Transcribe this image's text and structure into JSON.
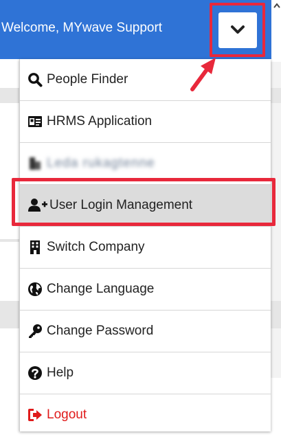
{
  "header": {
    "welcome_text": "Welcome, MYwave Support",
    "toggle_icon": "chevron-down-icon",
    "background": "#2f73d6"
  },
  "menu": {
    "items": [
      {
        "label": "People Finder",
        "icon": "search-icon"
      },
      {
        "label": "HRMS Application",
        "icon": "id-card-icon"
      },
      {
        "label": "Leda rukagtenne",
        "icon": "building-icon",
        "blurred": true
      },
      {
        "label": "User Login Management",
        "icon": "user-plus-icon",
        "highlighted": true
      },
      {
        "label": "Switch Company",
        "icon": "building-icon"
      },
      {
        "label": "Change Language",
        "icon": "globe-icon"
      },
      {
        "label": "Change Password",
        "icon": "key-icon"
      },
      {
        "label": "Help",
        "icon": "question-circle-icon"
      },
      {
        "label": "Logout",
        "icon": "sign-out-icon",
        "color": "#e01b1b"
      }
    ]
  },
  "annotation": {
    "color": "#e8283b"
  }
}
